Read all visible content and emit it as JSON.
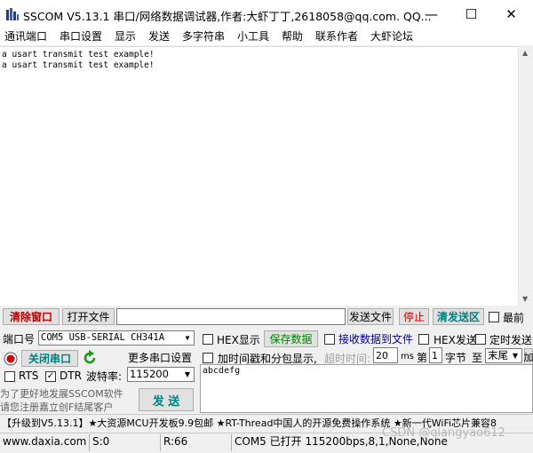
{
  "window": {
    "title": "SSCOM V5.13.1 串口/网络数据调试器,作者:大虾丁丁,2618058@qq.com. QQ...",
    "controls": [
      "—",
      "☐",
      "✕"
    ]
  },
  "menu": [
    "通讯端口",
    "串口设置",
    "显示",
    "发送",
    "多字符串",
    "小工具",
    "帮助",
    "联系作者",
    "大虾论坛"
  ],
  "receive": {
    "lines": [
      "a usart transmit test example!",
      "a usart transmit test example!"
    ]
  },
  "toolbar": {
    "clear_label": "清除窗口",
    "open_file_label": "打开文件",
    "file_path": "",
    "send_file_label": "发送文件",
    "stop_label": "停止",
    "clear_send_label": "清发送区",
    "topmost_label": "最前"
  },
  "port": {
    "port_label": "端口号",
    "port_value": "COM5 USB-SERIAL CH341A",
    "close_port_label": "关闭串口",
    "more_settings_label": "更多串口设置",
    "rts_label": "RTS",
    "dtr_label": "DTR",
    "baud_label": "波特率:",
    "baud_value": "115200"
  },
  "options": {
    "hex_display_label": "HEX显示",
    "save_data_label": "保存数据",
    "recv_to_file_label": "接收数据到文件",
    "hex_send_label": "HEX发送",
    "timed_send_label": "定时发送",
    "timestamp_label": "加时间戳和分包显示,",
    "timeout_label": "超时时间:",
    "timeout_value": "20",
    "timeout_unit": "ms",
    "nth_label": "第",
    "nth_value": "1",
    "byte_label": "字节",
    "to_label": "至",
    "end_value": "末尾",
    "add_label": "加"
  },
  "send": {
    "text": "abcdefg",
    "button_label": "发 送",
    "promo_line1": "为了更好地发展SSCOM软件",
    "promo_line2": "请您注册嘉立创F结尾客户"
  },
  "ad": {
    "text": "【升级到V5.13.1】★大资源MCU开发板9.9包邮 ★RT-Thread中国人的开源免费操作系统 ★新一代WiFi芯片兼容8"
  },
  "status": {
    "site": "www.daxia.com",
    "sent": "S:0",
    "received": "R:66",
    "port_state": "COM5 已打开  115200bps,8,1,None,None"
  },
  "watermark": "CSDN @qiangyao612",
  "colors": {
    "red_button": "#c00000",
    "teal_button": "#008080",
    "green_button": "#008000",
    "record_icon": "#d00000",
    "refresh_icon": "#1a9a1a"
  }
}
